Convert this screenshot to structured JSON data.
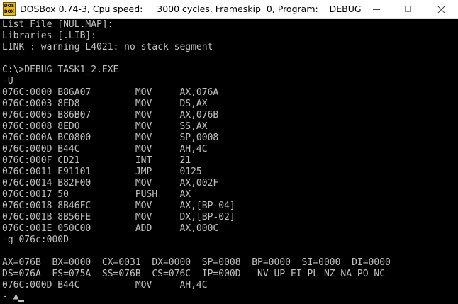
{
  "window": {
    "icon_text_top": "DOS",
    "icon_text_bottom": "BOX",
    "title": "DOSBox 0.74-3, Cpu speed:     3000 cycles, Frameskip  0, Program:    DEBUG"
  },
  "console": {
    "lines": [
      "List File [NUL.MAP]:",
      "Libraries [.LIB]:",
      "LINK : warning L4021: no stack segment",
      "",
      "C:\\>DEBUG TASK1_2.EXE",
      "-U",
      "076C:0000 B86A07        MOV     AX,076A",
      "076C:0003 8ED8          MOV     DS,AX",
      "076C:0005 B86B07        MOV     AX,076B",
      "076C:0008 8ED0          MOV     SS,AX",
      "076C:000A BC0800        MOV     SP,0008",
      "076C:000D B44C          MOV     AH,4C",
      "076C:000F CD21          INT     21",
      "076C:0011 E91101        JMP     0125",
      "076C:0014 B82F00        MOV     AX,002F",
      "076C:0017 50            PUSH    AX",
      "076C:0018 8B46FC        MOV     AX,[BP-04]",
      "076C:001B 8B56FE        MOV     DX,[BP-02]",
      "076C:001E 050C00        ADD     AX,000C",
      "-g 076c:000D",
      "",
      "AX=076B  BX=0000  CX=0031  DX=0000  SP=0008  BP=0000  SI=0000  DI=0000",
      "DS=076A  ES=075A  SS=076B  CS=076C  IP=000D   NV UP EI PL NZ NA PO NC",
      "076C:000D B44C          MOV     AH,4C"
    ],
    "prompt": "- ▲"
  }
}
